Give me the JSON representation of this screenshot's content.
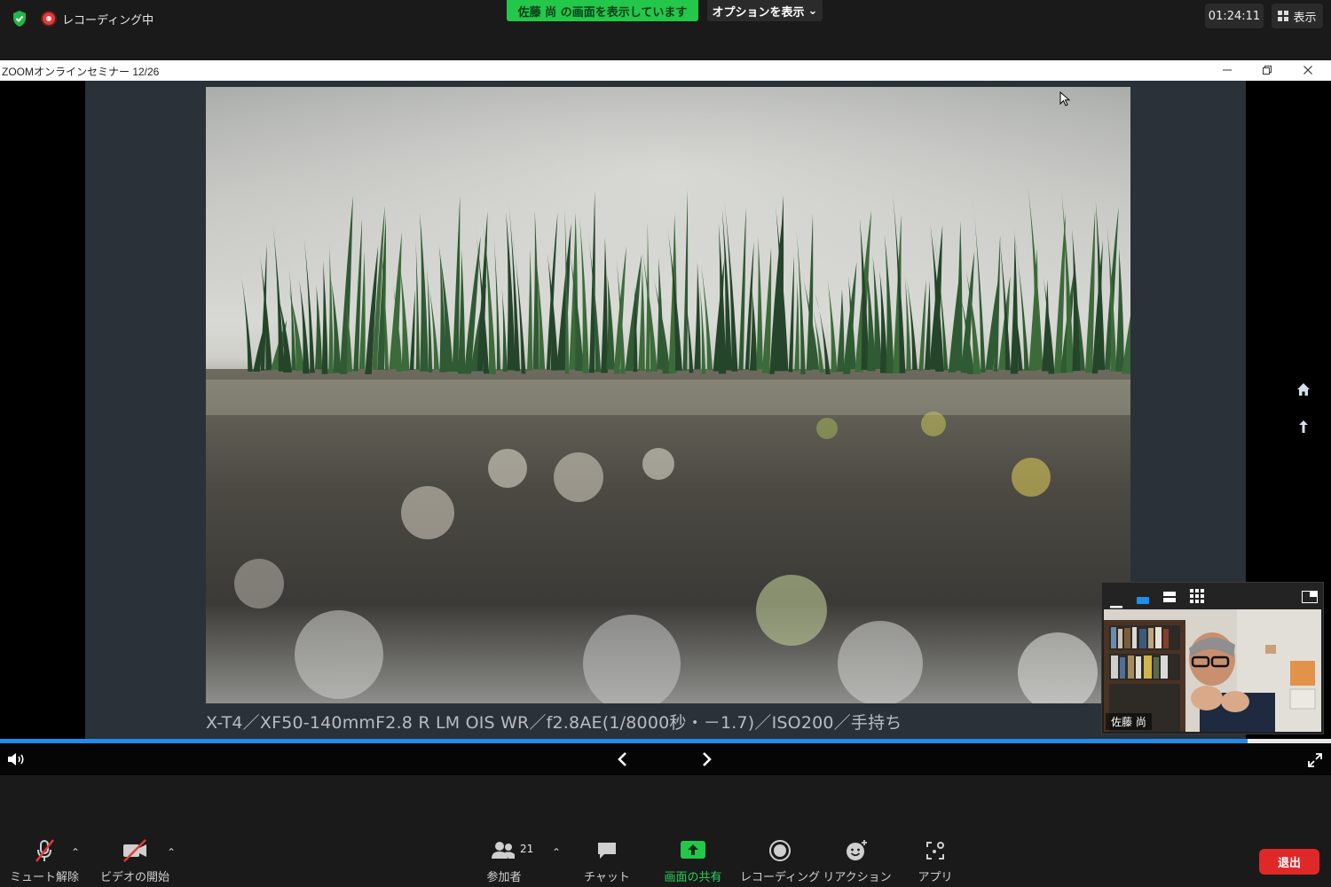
{
  "top_bar": {
    "recording_label": "レコーディング中",
    "sharing_banner": "佐藤 尚 の画面を表示しています",
    "options_label": "オプションを表示",
    "elapsed_time": "01:24:11",
    "view_label": "表示"
  },
  "window": {
    "title": "ZOOMオンラインセミナー 12/26"
  },
  "slide": {
    "caption": "X-T4／XF50-140mmF2.8 R LM OIS WR／f2.8AE(1/8000秒・－1.7)／ISO200／手持ち",
    "progress_fraction": 0.937
  },
  "thumbnail": {
    "participant_name": "佐藤 尚"
  },
  "toolbar": {
    "mute_label": "ミュート解除",
    "video_label": "ビデオの開始",
    "participants_label": "参加者",
    "participants_count": "21",
    "chat_label": "チャット",
    "share_label": "画面の共有",
    "record_label": "レコーディング",
    "reactions_label": "リアクション",
    "apps_label": "アプリ",
    "leave_label": "退出"
  },
  "colors": {
    "accent_green": "#23c84a",
    "leave_red": "#e02828",
    "progress_blue": "#1f8ded"
  }
}
